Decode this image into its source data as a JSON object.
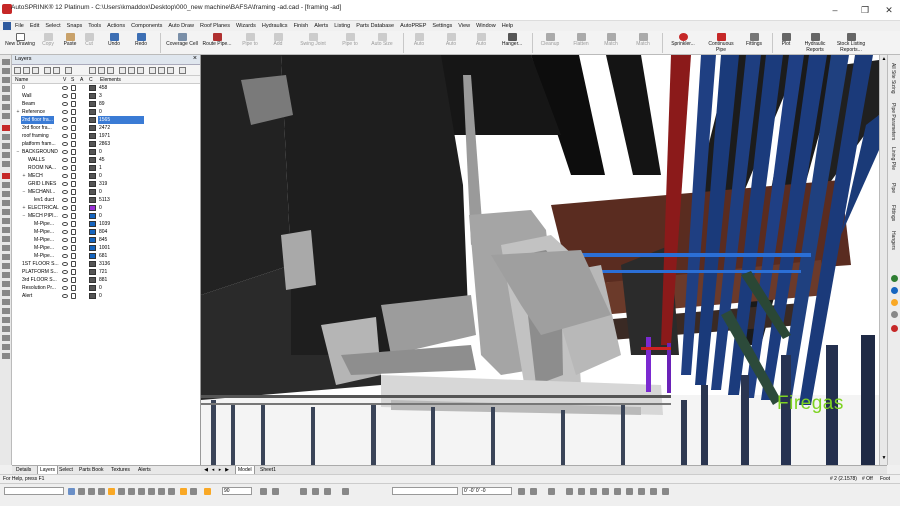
{
  "window": {
    "title": "AutoSPRINK® 12 Platinum - C:\\Users\\kmaddox\\Desktop\\000_new machine\\BAFSA\\framing -ad.cad - [framing -ad]"
  },
  "menu": [
    "File",
    "Edit",
    "Select",
    "Snaps",
    "Tools",
    "Actions",
    "Components",
    "Auto Draw",
    "Roof Planes",
    "Wizards",
    "Hydraulics",
    "Finish",
    "Alerts",
    "Listing",
    "Parts Database",
    "AutoPREP",
    "Settings",
    "View",
    "Window",
    "Help"
  ],
  "toolbar": {
    "new_drawing": "New Drawing",
    "copy": "Copy",
    "paste": "Paste",
    "cut": "Cut",
    "undo": "Undo",
    "redo": "Redo",
    "coverage_cell": "Coverage Cell",
    "route_pipe": "Route Pipe...",
    "pipe_to": "Pipe to",
    "add": "Add",
    "swing_joint": "Swing Joint",
    "pipe_to_2": "Pipe to",
    "auto_size": "Auto Size",
    "auto": "Auto",
    "auto_2": "Auto",
    "auto_3": "Auto",
    "hanger": "Hanger...",
    "cleanup": "Cleanup",
    "flatten": "Flatten",
    "match": "Match",
    "match_2": "Match",
    "sprinkler": "Sprinkler...",
    "continuous_pipe": "Continuous Pipe",
    "fittings": "Fittings",
    "plot": "Plot",
    "hydraulic_reports": "Hydraulic Reports",
    "stock_listing_reports": "Stock Listing Reports..."
  },
  "layers_panel": {
    "title": "Layers",
    "columns": {
      "name": "Name",
      "v": "V",
      "s": "S",
      "a": "A",
      "c": "C",
      "elements": "Elements"
    },
    "rows": [
      {
        "name": "0",
        "elements": "458",
        "color": "#555555",
        "indent": 0,
        "toggle": ""
      },
      {
        "name": "Wall",
        "elements": "3",
        "color": "#555555",
        "indent": 0,
        "toggle": "",
        "lock": true
      },
      {
        "name": "Beam",
        "elements": "89",
        "color": "#555555",
        "indent": 0,
        "toggle": ""
      },
      {
        "name": "Reference",
        "elements": "0",
        "color": "#555555",
        "indent": 0,
        "toggle": "+"
      },
      {
        "name": "2nd floor fra...",
        "elements": "1565",
        "color": "#555555",
        "indent": 0,
        "toggle": "",
        "selected": true
      },
      {
        "name": "3rd floor fra...",
        "elements": "2472",
        "color": "#555555",
        "indent": 0,
        "toggle": ""
      },
      {
        "name": "roof framing",
        "elements": "1971",
        "color": "#555555",
        "indent": 0,
        "toggle": ""
      },
      {
        "name": "platform fram...",
        "elements": "2863",
        "color": "#555555",
        "indent": 0,
        "toggle": ""
      },
      {
        "name": "BACKGROUND",
        "elements": "0",
        "color": "#555555",
        "indent": 0,
        "toggle": "−"
      },
      {
        "name": "WALLS",
        "elements": "45",
        "color": "#555555",
        "indent": 1,
        "toggle": ""
      },
      {
        "name": "ROOM NA...",
        "elements": "1",
        "color": "#555555",
        "indent": 1,
        "toggle": ""
      },
      {
        "name": "MECH",
        "elements": "0",
        "color": "#555555",
        "indent": 1,
        "toggle": "+"
      },
      {
        "name": "GRID LINES",
        "elements": "319",
        "color": "#555555",
        "indent": 1,
        "toggle": ""
      },
      {
        "name": "MECHANI...",
        "elements": "0",
        "color": "#555555",
        "indent": 1,
        "toggle": "−"
      },
      {
        "name": "lev1 duct",
        "elements": "5113",
        "color": "#555555",
        "indent": 2,
        "toggle": ""
      },
      {
        "name": "ELECTRICAL",
        "elements": "0",
        "color": "#9b30d9",
        "indent": 1,
        "toggle": "+"
      },
      {
        "name": "MECH PIPI...",
        "elements": "0",
        "color": "#1565c0",
        "indent": 1,
        "toggle": "−"
      },
      {
        "name": "M-Pipe...",
        "elements": "1039",
        "color": "#1565c0",
        "indent": 2,
        "toggle": ""
      },
      {
        "name": "M-Pipe...",
        "elements": "804",
        "color": "#1565c0",
        "indent": 2,
        "toggle": ""
      },
      {
        "name": "M-Pipe...",
        "elements": "845",
        "color": "#1565c0",
        "indent": 2,
        "toggle": ""
      },
      {
        "name": "M-Pipe...",
        "elements": "1001",
        "color": "#1565c0",
        "indent": 2,
        "toggle": ""
      },
      {
        "name": "M-Pipe...",
        "elements": "681",
        "color": "#1565c0",
        "indent": 2,
        "toggle": ""
      },
      {
        "name": "1ST FLOOR S...",
        "elements": "3136",
        "color": "#555555",
        "indent": 0,
        "toggle": ""
      },
      {
        "name": "PLATFORM S...",
        "elements": "721",
        "color": "#555555",
        "indent": 0,
        "toggle": ""
      },
      {
        "name": "3rd FLOOR S...",
        "elements": "881",
        "color": "#555555",
        "indent": 0,
        "toggle": ""
      },
      {
        "name": "Resolution Pr...",
        "elements": "0",
        "color": "#555555",
        "indent": 0,
        "toggle": ""
      },
      {
        "name": "Alert",
        "elements": "0",
        "color": "#555555",
        "indent": 0,
        "toggle": ""
      }
    ]
  },
  "panel_tabs": [
    "Details",
    "Layers",
    "Select",
    "Parts Book",
    "Textures",
    "Alerts"
  ],
  "active_panel_tab": "Layers",
  "sheet_tabs": [
    "Model",
    "Sheet1"
  ],
  "active_sheet_tab": "Model",
  "right_tabs": [
    "All Site Sizing",
    "Pipe Parameters",
    "Lining Pile",
    "Pipe",
    "Fittings",
    "Hangers"
  ],
  "watermark": "Firegas",
  "status": {
    "help": "For Help, press F1",
    "scale": "# 2 (2.1578)",
    "mode": "# Off",
    "units": "Foot",
    "zoom_value": "90",
    "coords": "0' -0' 0' -0"
  }
}
